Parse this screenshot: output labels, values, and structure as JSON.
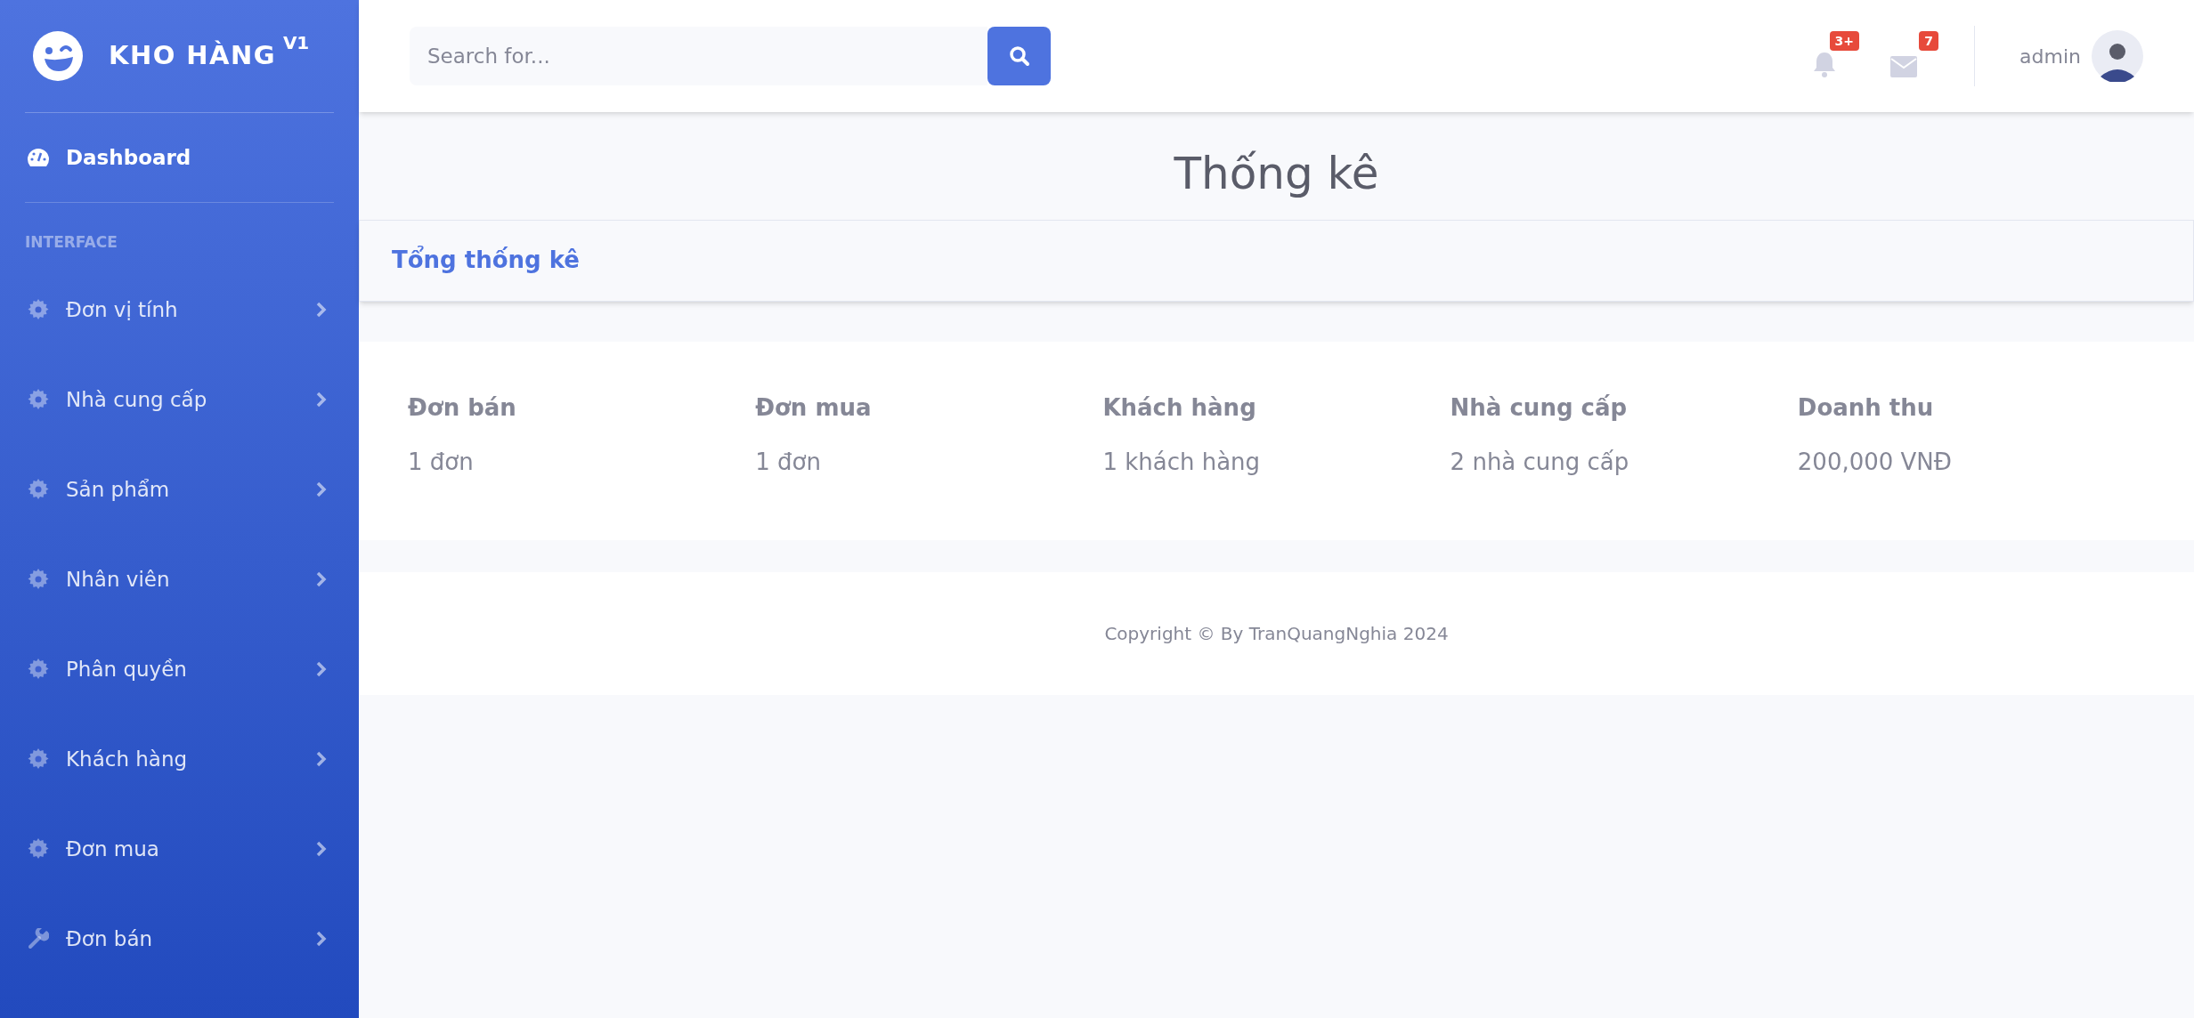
{
  "sidebar": {
    "brand": "KHO HÀNG",
    "brand_sup": "V1",
    "heading": "INTERFACE",
    "items": [
      {
        "label": "Dashboard",
        "kind": "dashboard",
        "selected": true,
        "expandable": false
      },
      {
        "label": "Đơn vị tính",
        "kind": "gear",
        "selected": false,
        "expandable": true
      },
      {
        "label": "Nhà cung cấp",
        "kind": "gear",
        "selected": false,
        "expandable": true
      },
      {
        "label": "Sản phẩm",
        "kind": "gear",
        "selected": false,
        "expandable": true
      },
      {
        "label": "Nhân viên",
        "kind": "gear",
        "selected": false,
        "expandable": true
      },
      {
        "label": "Phân quyền",
        "kind": "gear",
        "selected": false,
        "expandable": true
      },
      {
        "label": "Khách hàng",
        "kind": "gear",
        "selected": false,
        "expandable": true
      },
      {
        "label": "Đơn mua",
        "kind": "gear",
        "selected": false,
        "expandable": true
      },
      {
        "label": "Đơn bán",
        "kind": "wrench",
        "selected": false,
        "expandable": true
      }
    ]
  },
  "topbar": {
    "search": {
      "placeholder": "Search for..."
    },
    "alerts_badge": "3+",
    "messages_badge": "7",
    "user": "admin"
  },
  "page_title": "Thống kê",
  "card_title": "Tổng thống kê",
  "stats": [
    {
      "label": "Đơn bán",
      "value": "1 đơn"
    },
    {
      "label": "Đơn mua",
      "value": "1 đơn"
    },
    {
      "label": "Khách hàng",
      "value": "1 khách hàng"
    },
    {
      "label": "Nhà cung cấp",
      "value": "2 nhà cung cấp"
    },
    {
      "label": "Doanh thu",
      "value": "200,000 VNĐ"
    }
  ],
  "footer": "Copyright © By TranQuangNghia 2024"
}
